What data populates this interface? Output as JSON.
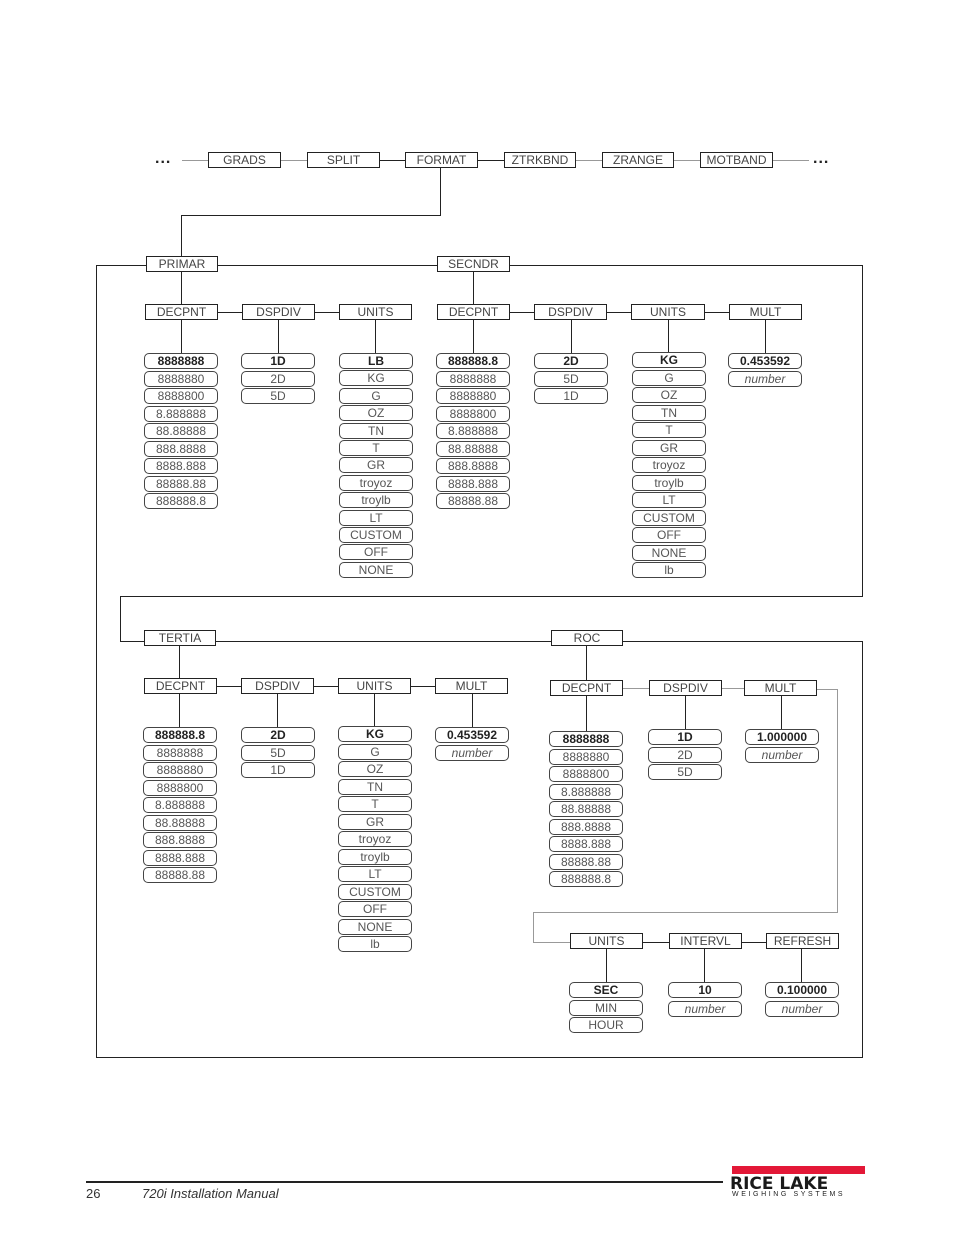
{
  "top_menu": {
    "ellipsis_left": "...",
    "ellipsis_right": "...",
    "items": [
      "GRADS",
      "SPLIT",
      "FORMAT",
      "ZTRKBND",
      "ZRANGE",
      "MOTBAND"
    ]
  },
  "primar": {
    "label": "PRIMAR",
    "decpnt": {
      "label": "DECPNT",
      "options": [
        "8888888",
        "8888880",
        "8888800",
        "8.888888",
        "88.88888",
        "888.8888",
        "8888.888",
        "88888.88",
        "888888.8"
      ]
    },
    "dspdiv": {
      "label": "DSPDIV",
      "options": [
        "1D",
        "2D",
        "5D"
      ]
    },
    "units": {
      "label": "UNITS",
      "options": [
        "LB",
        "KG",
        "G",
        "OZ",
        "TN",
        "T",
        "GR",
        "troyoz",
        "troylb",
        "LT",
        "CUSTOM",
        "OFF",
        "NONE"
      ]
    }
  },
  "secndr": {
    "label": "SECNDR",
    "decpnt": {
      "label": "DECPNT",
      "options": [
        "888888.8",
        "8888888",
        "8888880",
        "8888800",
        "8.888888",
        "88.88888",
        "888.8888",
        "8888.888",
        "88888.88"
      ]
    },
    "dspdiv": {
      "label": "DSPDIV",
      "options": [
        "2D",
        "5D",
        "1D"
      ]
    },
    "units": {
      "label": "UNITS",
      "options": [
        "KG",
        "G",
        "OZ",
        "TN",
        "T",
        "GR",
        "troyoz",
        "troylb",
        "LT",
        "CUSTOM",
        "OFF",
        "NONE",
        "lb"
      ]
    },
    "mult": {
      "label": "MULT",
      "options": [
        "0.453592",
        "number"
      ]
    }
  },
  "tertia": {
    "label": "TERTIA",
    "decpnt": {
      "label": "DECPNT",
      "options": [
        "888888.8",
        "8888888",
        "8888880",
        "8888800",
        "8.888888",
        "88.88888",
        "888.8888",
        "8888.888",
        "88888.88"
      ]
    },
    "dspdiv": {
      "label": "DSPDIV",
      "options": [
        "2D",
        "5D",
        "1D"
      ]
    },
    "units": {
      "label": "UNITS",
      "options": [
        "KG",
        "G",
        "OZ",
        "TN",
        "T",
        "GR",
        "troyoz",
        "troylb",
        "LT",
        "CUSTOM",
        "OFF",
        "NONE",
        "lb"
      ]
    },
    "mult": {
      "label": "MULT",
      "options": [
        "0.453592",
        "number"
      ]
    }
  },
  "roc": {
    "label": "ROC",
    "decpnt": {
      "label": "DECPNT",
      "options": [
        "8888888",
        "8888880",
        "8888800",
        "8.888888",
        "88.88888",
        "888.8888",
        "8888.888",
        "88888.88",
        "888888.8"
      ]
    },
    "dspdiv": {
      "label": "DSPDIV",
      "options": [
        "1D",
        "2D",
        "5D"
      ]
    },
    "mult": {
      "label": "MULT",
      "options": [
        "1.000000",
        "number"
      ]
    },
    "units": {
      "label": "UNITS",
      "options": [
        "SEC",
        "MIN",
        "HOUR"
      ]
    },
    "intervl": {
      "label": "INTERVL",
      "options": [
        "10",
        "number"
      ]
    },
    "refresh": {
      "label": "REFRESH",
      "options": [
        "0.100000",
        "number"
      ]
    }
  },
  "footer": {
    "page_number": "26",
    "manual_title": "720i Installation Manual",
    "logo_main": "RICE LAKE",
    "logo_sub": "WEIGHING SYSTEMS",
    "logo_color": "#e31837"
  }
}
